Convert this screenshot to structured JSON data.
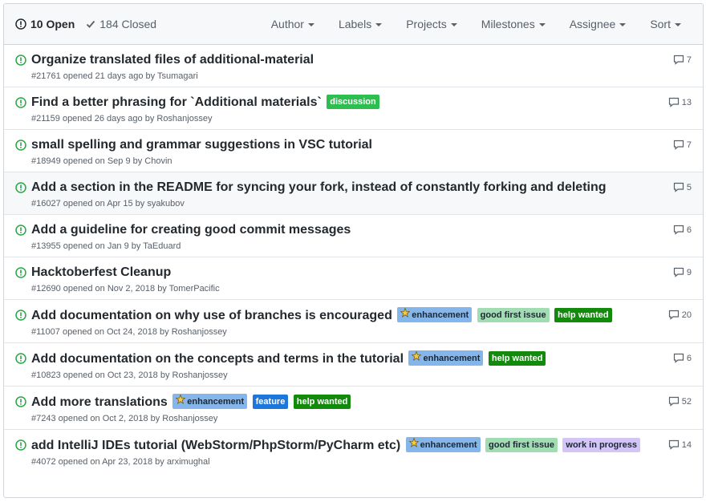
{
  "states": {
    "open": "10 Open",
    "closed": "184 Closed"
  },
  "filters": [
    "Author",
    "Labels",
    "Projects",
    "Milestones",
    "Assignee",
    "Sort"
  ],
  "colors": {
    "open_icon": "#28a745",
    "discussion": "#2cbe4e",
    "enhancement": "#84b6eb",
    "good_first_issue": "#a2dcb3",
    "help_wanted": "#128a0c",
    "feature": "#1d76db",
    "work_in_progress": "#d4c5f9"
  },
  "issues": [
    {
      "title": "Organize translated files of additional-material",
      "meta": "#21761 opened 21 days ago by Tsumagari",
      "comments": "7",
      "labels": []
    },
    {
      "title": "Find a better phrasing for `Additional materials`",
      "meta": "#21159 opened 26 days ago by Roshanjossey",
      "comments": "13",
      "labels": [
        {
          "text": "discussion",
          "bg": "#2cbe4e",
          "fg": "#ffffff"
        }
      ]
    },
    {
      "title": "small spelling and grammar suggestions in VSC tutorial",
      "meta": "#18949 opened on Sep 9 by Chovin",
      "comments": "7",
      "labels": []
    },
    {
      "title": "Add a section in the README for syncing your fork, instead of constantly forking and deleting",
      "meta": "#16027 opened on Apr 15 by syakubov",
      "comments": "5",
      "labels": []
    },
    {
      "title": "Add a guideline for creating good commit messages",
      "meta": "#13955 opened on Jan 9 by TaEduard",
      "comments": "6",
      "labels": []
    },
    {
      "title": "Hacktoberfest Cleanup",
      "meta": "#12690 opened on Nov 2, 2018 by TomerPacific",
      "comments": "9",
      "labels": []
    },
    {
      "title": "Add documentation on why use of branches is encouraged",
      "meta": "#11007 opened on Oct 24, 2018 by Roshanjossey",
      "comments": "20",
      "labels": [
        {
          "text": "enhancement",
          "bg": "#84b6eb",
          "fg": "#1c2733",
          "icon": true
        },
        {
          "text": "good first issue",
          "bg": "#a2dcb3",
          "fg": "#1c2733"
        },
        {
          "text": "help wanted",
          "bg": "#128a0c",
          "fg": "#ffffff"
        }
      ]
    },
    {
      "title": "Add documentation on the concepts and terms in the tutorial",
      "meta": "#10823 opened on Oct 23, 2018 by Roshanjossey",
      "comments": "6",
      "labels": [
        {
          "text": "enhancement",
          "bg": "#84b6eb",
          "fg": "#1c2733",
          "icon": true
        },
        {
          "text": "help wanted",
          "bg": "#128a0c",
          "fg": "#ffffff"
        }
      ]
    },
    {
      "title": "Add more translations",
      "meta": "#7243 opened on Oct 2, 2018 by Roshanjossey",
      "comments": "52",
      "labels": [
        {
          "text": "enhancement",
          "bg": "#84b6eb",
          "fg": "#1c2733",
          "icon": true
        },
        {
          "text": "feature",
          "bg": "#1d76db",
          "fg": "#ffffff"
        },
        {
          "text": "help wanted",
          "bg": "#128a0c",
          "fg": "#ffffff"
        }
      ]
    },
    {
      "title": "add IntelliJ IDEs tutorial (WebStorm/PhpStorm/PyCharm etc)",
      "meta": "#4072 opened on Apr 23, 2018 by arximughal",
      "comments": "14",
      "labels": [
        {
          "text": "enhancement",
          "bg": "#84b6eb",
          "fg": "#1c2733",
          "icon": true
        },
        {
          "text": "good first issue",
          "bg": "#a2dcb3",
          "fg": "#1c2733"
        },
        {
          "text": "work in progress",
          "bg": "#d4c5f9",
          "fg": "#1c2733"
        }
      ]
    }
  ]
}
